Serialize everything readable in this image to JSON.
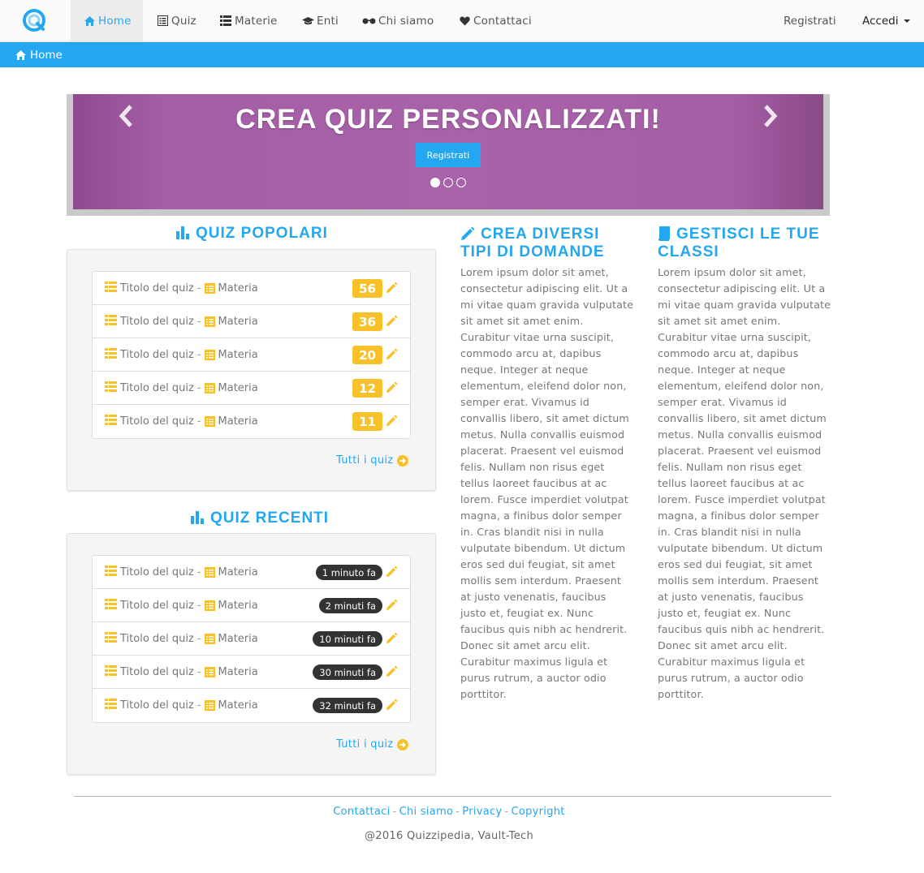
{
  "nav": {
    "items": [
      {
        "label": "Home",
        "icon": "home-icon",
        "active": true
      },
      {
        "label": "Quiz",
        "icon": "list-alt-icon"
      },
      {
        "label": "Materie",
        "icon": "list-icon"
      },
      {
        "label": "Enti",
        "icon": "graduation-cap-icon"
      },
      {
        "label": "Chi siamo",
        "icon": "glasses-icon"
      },
      {
        "label": "Contattaci",
        "icon": "heart-icon"
      }
    ],
    "register": "Registrati",
    "login": "Accedi"
  },
  "breadcrumb": {
    "home": "Home"
  },
  "carousel": {
    "title": "CREA QUIZ PERSONALIZZATI!",
    "button": "Registrati",
    "slides": 3,
    "active_slide": 1
  },
  "popular": {
    "title": "QUIZ POPOLARI",
    "rows": [
      {
        "title": "Titolo del quiz",
        "sep": "-",
        "subject": "Materia",
        "count": "56"
      },
      {
        "title": "Titolo del quiz",
        "sep": "-",
        "subject": "Materia",
        "count": "36"
      },
      {
        "title": "Titolo del quiz",
        "sep": "-",
        "subject": "Materia",
        "count": "20"
      },
      {
        "title": "Titolo del quiz",
        "sep": "-",
        "subject": "Materia",
        "count": "12"
      },
      {
        "title": "Titolo del quiz",
        "sep": "-",
        "subject": "Materia",
        "count": "11"
      }
    ],
    "all_link": "Tutti i quiz"
  },
  "recent": {
    "title": "QUIZ RECENTI",
    "rows": [
      {
        "title": "Titolo del quiz",
        "sep": "-",
        "subject": "Materia",
        "time": "1 minuto fa"
      },
      {
        "title": "Titolo del quiz",
        "sep": "-",
        "subject": "Materia",
        "time": "2 minuti fa"
      },
      {
        "title": "Titolo del quiz",
        "sep": "-",
        "subject": "Materia",
        "time": "10 minuti fa"
      },
      {
        "title": "Titolo del quiz",
        "sep": "-",
        "subject": "Materia",
        "time": "30 minuti fa"
      },
      {
        "title": "Titolo del quiz",
        "sep": "-",
        "subject": "Materia",
        "time": "32 minuti fa"
      }
    ],
    "all_link": "Tutti i quiz"
  },
  "features": [
    {
      "title_line1": "CREA DIVERSI",
      "title_line2": "TIPI DI DOMANDE",
      "icon": "pencil-icon",
      "body": "Lorem ipsum dolor sit amet, consectetur adipiscing elit. Ut a mi vitae quam gravida vulputate sit amet sit amet enim. Curabitur vitae urna suscipit, commodo arcu at, dapibus neque. Integer at neque elementum, eleifend dolor non, semper erat. Vivamus id convallis libero, sit amet dictum metus. Nulla convallis euismod placerat. Praesent vel euismod felis. Nullam non risus eget tellus laoreet faucibus at ac lorem. Fusce imperdiet volutpat magna, a finibus dolor semper in. Cras blandit nisi in nulla vulputate bibendum. Ut dictum eros sed dui feugiat, sit amet mollis sem interdum. Praesent at justo venenatis, faucibus justo et, feugiat ex. Nunc faucibus quis nibh ac hendrerit. Donec sit amet arcu elit. Curabitur maximus ligula et purus rutrum, a auctor odio porttitor."
    },
    {
      "title_line1": "GESTISCI LE TUE",
      "title_line2": "CLASSI",
      "icon": "book-icon",
      "body": "Lorem ipsum dolor sit amet, consectetur adipiscing elit. Ut a mi vitae quam gravida vulputate sit amet sit amet enim. Curabitur vitae urna suscipit, commodo arcu at, dapibus neque. Integer at neque elementum, eleifend dolor non, semper erat. Vivamus id convallis libero, sit amet dictum metus. Nulla convallis euismod placerat. Praesent vel euismod felis. Nullam non risus eget tellus laoreet faucibus at ac lorem. Fusce imperdiet volutpat magna, a finibus dolor semper in. Cras blandit nisi in nulla vulputate bibendum. Ut dictum eros sed dui feugiat, sit amet mollis sem interdum. Praesent at justo venenatis, faucibus justo et, feugiat ex. Nunc faucibus quis nibh ac hendrerit. Donec sit amet arcu elit. Curabitur maximus ligula et purus rutrum, a auctor odio porttitor."
    }
  ],
  "footer": {
    "links": [
      "Contattaci",
      "Chi siamo",
      "Privacy",
      "Copyright"
    ],
    "separator": "-",
    "copyright": "@2016 Quizzipedia, Vault-Tech"
  },
  "colors": {
    "primary": "#22a7f0",
    "accent": "#f8c12a",
    "carousel": "#a862a8",
    "dark_badge": "#333333"
  }
}
